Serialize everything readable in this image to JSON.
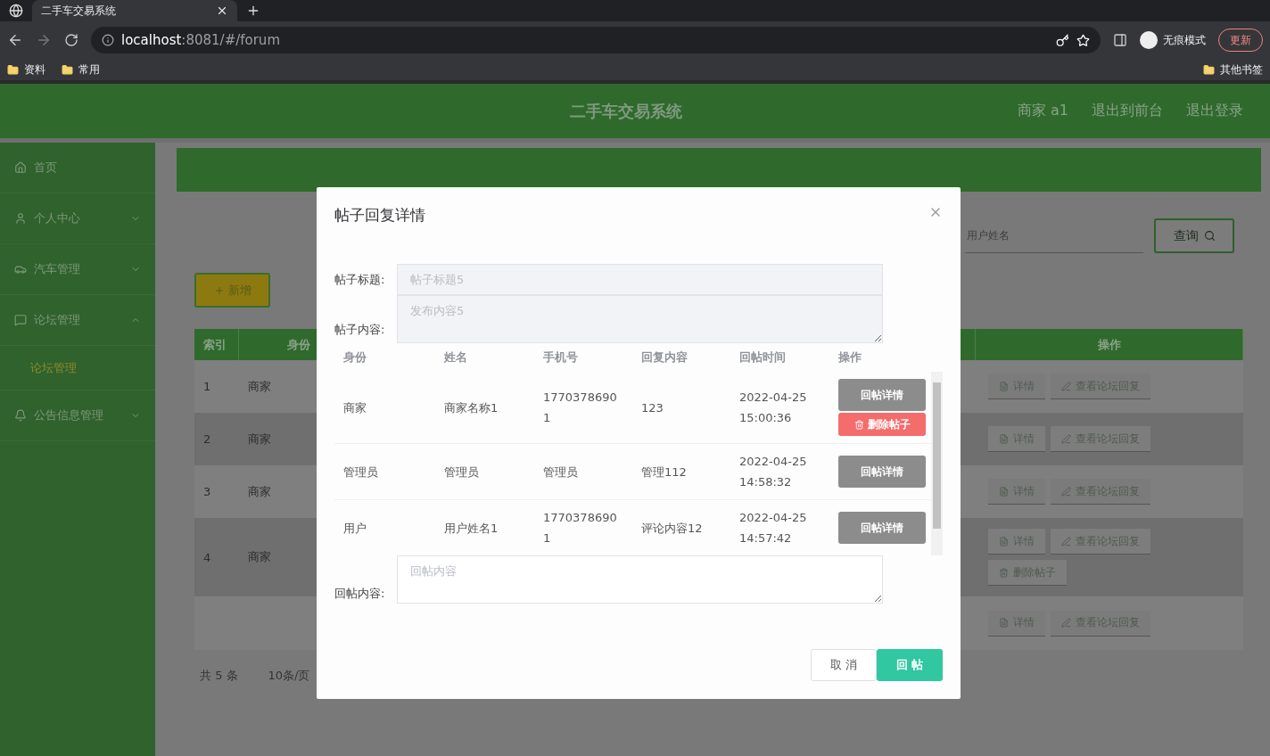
{
  "browser": {
    "tab_title": "二手车交易系统",
    "url_host": "localhost",
    "url_rest": ":8081/#/forum",
    "bookmarks": [
      "资料",
      "常用"
    ],
    "other_bookmarks": "其他书签",
    "incognito": "无痕模式",
    "update": "更新"
  },
  "header": {
    "title": "二手车交易系统",
    "user": "商家 a1",
    "links": [
      "退出到前台",
      "退出登录"
    ]
  },
  "sidebar": {
    "items": [
      {
        "label": "首页"
      },
      {
        "label": "个人中心",
        "expanded": false
      },
      {
        "label": "汽车管理",
        "expanded": false
      },
      {
        "label": "论坛管理",
        "expanded": true,
        "children": [
          {
            "label": "论坛管理",
            "selected": true
          }
        ]
      },
      {
        "label": "公告信息管理",
        "expanded": false
      }
    ]
  },
  "search": {
    "placeholder": "用户姓名",
    "button": "查询"
  },
  "add_button": "新增",
  "table": {
    "columns": [
      "索引",
      "身份",
      "操作"
    ],
    "rows": [
      {
        "index": "1",
        "identity": "商家",
        "actions": [
          "详情",
          "查看论坛回复"
        ]
      },
      {
        "index": "2",
        "identity": "商家",
        "actions": [
          "详情",
          "查看论坛回复"
        ]
      },
      {
        "index": "3",
        "identity": "商家",
        "actions": [
          "详情",
          "查看论坛回复"
        ]
      },
      {
        "index": "4",
        "identity": "商家",
        "actions": [
          "详情",
          "查看论坛回复",
          "删除帖子"
        ]
      },
      {
        "actions": [
          "详情",
          "查看论坛回复"
        ]
      }
    ]
  },
  "pagination": {
    "total": "共 5 条",
    "page_size": "10条/页"
  },
  "dialog": {
    "title": "帖子回复详情",
    "title_field": {
      "label": "帖子标题:",
      "value": "帖子标题5",
      "disabled": true
    },
    "content_field": {
      "label": "帖子内容:",
      "value": "发布内容5",
      "disabled": true
    },
    "reply_columns": [
      "身份",
      "姓名",
      "手机号",
      "回复内容",
      "回帖时间",
      "操作"
    ],
    "replies": [
      {
        "identity": "商家",
        "name": "商家名称1",
        "phone": "17703786901",
        "content": "123",
        "time": "2022-04-25 15:00:36",
        "actions": [
          {
            "kind": "detail",
            "label": "回帖详情"
          },
          {
            "kind": "delete",
            "label": "删除帖子"
          }
        ]
      },
      {
        "identity": "管理员",
        "name": "管理员",
        "phone": "管理员",
        "content": "管理112",
        "time": "2022-04-25 14:58:32",
        "actions": [
          {
            "kind": "detail",
            "label": "回帖详情"
          }
        ]
      },
      {
        "identity": "用户",
        "name": "用户姓名1",
        "phone": "17703786901",
        "content": "评论内容12",
        "time": "2022-04-25 14:57:42",
        "actions": [
          {
            "kind": "detail",
            "label": "回帖详情"
          }
        ]
      }
    ],
    "reply_field": {
      "label": "回帖内容:",
      "placeholder": "回帖内容"
    },
    "buttons": [
      {
        "kind": "cancel",
        "label": "取 消"
      },
      {
        "kind": "primary",
        "label": "回 帖"
      }
    ]
  }
}
